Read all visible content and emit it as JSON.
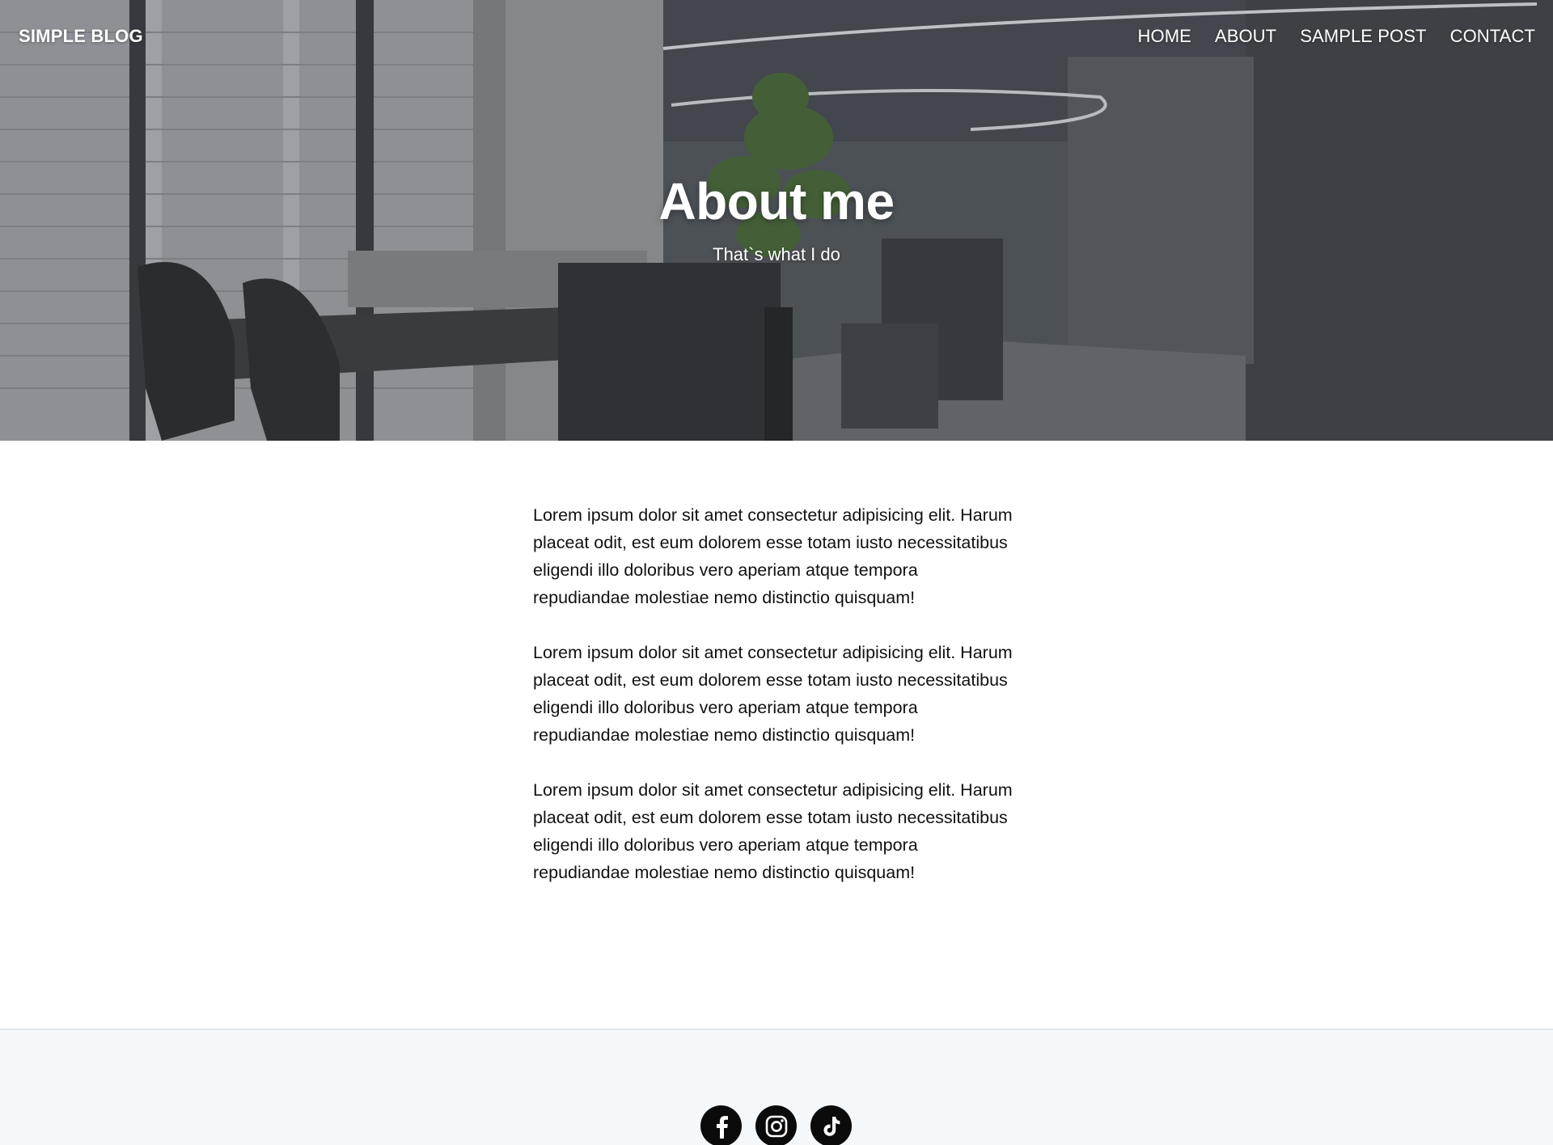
{
  "header": {
    "brand": "SIMPLE BLOG",
    "nav": [
      "HOME",
      "ABOUT",
      "SAMPLE POST",
      "CONTACT"
    ]
  },
  "hero": {
    "title": "About me",
    "subtitle": "That`s what I do"
  },
  "content": {
    "paragraphs": [
      "Lorem ipsum dolor sit amet consectetur adipisicing elit. Harum placeat odit, est eum dolorem esse totam iusto necessitatibus eligendi illo doloribus vero aperiam atque tempora repudiandae molestiae nemo distinctio quisquam!",
      "Lorem ipsum dolor sit amet consectetur adipisicing elit. Harum placeat odit, est eum dolorem esse totam iusto necessitatibus eligendi illo doloribus vero aperiam atque tempora repudiandae molestiae nemo distinctio quisquam!",
      "Lorem ipsum dolor sit amet consectetur adipisicing elit. Harum placeat odit, est eum dolorem esse totam iusto necessitatibus eligendi illo doloribus vero aperiam atque tempora repudiandae molestiae nemo distinctio quisquam!"
    ]
  },
  "footer": {
    "socials": [
      "facebook-icon",
      "instagram-icon",
      "tiktok-icon"
    ]
  },
  "colors": {
    "footer_bg": "#f5f8fb",
    "social_icon_bg": "#0b0b0b",
    "hero_text": "#ffffff"
  }
}
